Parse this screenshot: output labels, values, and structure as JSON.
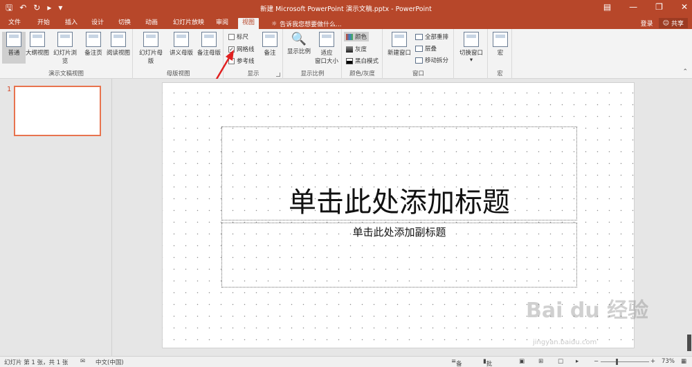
{
  "titlebar": {
    "title": "新建 Microsoft PowerPoint 演示文稿.pptx - PowerPoint",
    "qat": [
      "save-icon",
      "undo-icon",
      "redo-icon",
      "customize-icon"
    ]
  },
  "tabs": [
    {
      "label": "文件",
      "active": false
    },
    {
      "label": "开始",
      "active": false
    },
    {
      "label": "插入",
      "active": false
    },
    {
      "label": "设计",
      "active": false
    },
    {
      "label": "切换",
      "active": false
    },
    {
      "label": "动画",
      "active": false
    },
    {
      "label": "幻灯片放映",
      "active": false
    },
    {
      "label": "审阅",
      "active": false
    },
    {
      "label": "视图",
      "active": true
    }
  ],
  "tellme": "告诉我您想要做什么...",
  "account": {
    "login": "登录",
    "share": "共享"
  },
  "ribbon": {
    "presentation_views": {
      "label": "演示文稿视图",
      "buttons": [
        "普通",
        "大纲视图",
        "幻灯片浏览",
        "备注页",
        "阅读视图"
      ]
    },
    "master_views": {
      "label": "母版视图",
      "buttons": [
        "幻灯片母版",
        "讲义母版",
        "备注母版"
      ]
    },
    "show": {
      "label": "显示",
      "ruler": "标尺",
      "gridlines": "网格线",
      "guides": "参考线",
      "notes": "备注",
      "gridlines_checked": true
    },
    "zoom": {
      "label": "显示比例",
      "zoom_btn": "显示比例",
      "fit_btn_line1": "适应",
      "fit_btn_line2": "窗口大小"
    },
    "color": {
      "label": "颜色/灰度",
      "items": [
        "颜色",
        "灰度",
        "黑白模式"
      ]
    },
    "window": {
      "label": "窗口",
      "new_window": "新建窗口",
      "items": [
        "全部重排",
        "层叠",
        "移动拆分"
      ]
    },
    "switch": {
      "label": "",
      "button": "切换窗口"
    },
    "macro": {
      "label": "宏",
      "button": "宏"
    }
  },
  "thumbnail": {
    "number": "1"
  },
  "slide": {
    "title_placeholder": "单击此处添加标题",
    "subtitle_placeholder": "单击此处添加副标题"
  },
  "statusbar": {
    "slide_info": "幻灯片 第 1 张，共 1 张",
    "language": "中文(中国)",
    "notes": "备注",
    "comments": "批注",
    "zoom": "73%"
  },
  "watermark": {
    "main": "Bai du 经验",
    "sub": "jingyan.baidu.com"
  },
  "colors": {
    "accent": "#b7472a",
    "selection": "#e8734e"
  }
}
